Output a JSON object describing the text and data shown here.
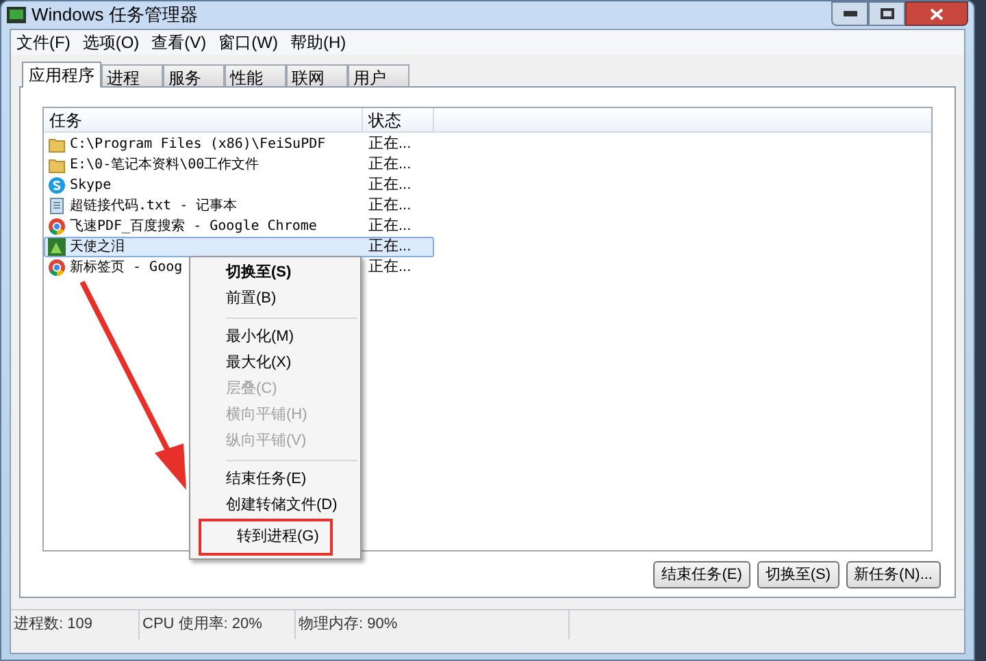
{
  "window": {
    "title": "Windows 任务管理器"
  },
  "menu": [
    "文件(F)",
    "选项(O)",
    "查看(V)",
    "窗口(W)",
    "帮助(H)"
  ],
  "tabs": [
    {
      "label": "应用程序",
      "selected": true
    },
    {
      "label": "进程",
      "selected": false
    },
    {
      "label": "服务",
      "selected": false
    },
    {
      "label": "性能",
      "selected": false
    },
    {
      "label": "联网",
      "selected": false
    },
    {
      "label": "用户",
      "selected": false
    }
  ],
  "table": {
    "columns": [
      "任务",
      "状态"
    ],
    "rows": [
      {
        "kind": "folder",
        "task": "C:\\Program Files (x86)\\FeiSuPDF",
        "status": "正在...",
        "selected": false
      },
      {
        "kind": "folder",
        "task": "E:\\0-笔记本资料\\00工作文件",
        "status": "正在...",
        "selected": false
      },
      {
        "kind": "skype",
        "task": "Skype",
        "status": "正在...",
        "selected": false
      },
      {
        "kind": "notepad",
        "task": "超链接代码.txt - 记事本",
        "status": "正在...",
        "selected": false
      },
      {
        "kind": "chrome",
        "task": "飞速PDF_百度搜索 - Google Chrome",
        "status": "正在...",
        "selected": false
      },
      {
        "kind": "game",
        "task": "天使之泪",
        "status": "正在...",
        "selected": true
      },
      {
        "kind": "chrome",
        "task": "新标签页 - Goog",
        "status": "正在...",
        "selected": false
      }
    ]
  },
  "context_menu": [
    {
      "kind": "item",
      "label": "切换至(S)",
      "default": true,
      "disabled": false,
      "highlighted": false
    },
    {
      "kind": "item",
      "label": "前置(B)",
      "default": false,
      "disabled": false,
      "highlighted": false
    },
    {
      "kind": "separator"
    },
    {
      "kind": "item",
      "label": "最小化(M)",
      "default": false,
      "disabled": false,
      "highlighted": false
    },
    {
      "kind": "item",
      "label": "最大化(X)",
      "default": false,
      "disabled": false,
      "highlighted": false
    },
    {
      "kind": "item",
      "label": "层叠(C)",
      "default": false,
      "disabled": true,
      "highlighted": false
    },
    {
      "kind": "item",
      "label": "横向平铺(H)",
      "default": false,
      "disabled": true,
      "highlighted": false
    },
    {
      "kind": "item",
      "label": "纵向平铺(V)",
      "default": false,
      "disabled": true,
      "highlighted": false
    },
    {
      "kind": "separator"
    },
    {
      "kind": "item",
      "label": "结束任务(E)",
      "default": false,
      "disabled": false,
      "highlighted": false
    },
    {
      "kind": "item",
      "label": "创建转储文件(D)",
      "default": false,
      "disabled": false,
      "highlighted": false
    },
    {
      "kind": "item",
      "label": "转到进程(G)",
      "default": false,
      "disabled": false,
      "highlighted": true
    }
  ],
  "buttons": [
    "结束任务(E)",
    "切换至(S)",
    "新任务(N)..."
  ],
  "status_bar": [
    "进程数: 109",
    "CPU 使用率: 20%",
    "物理内存: 90%"
  ]
}
